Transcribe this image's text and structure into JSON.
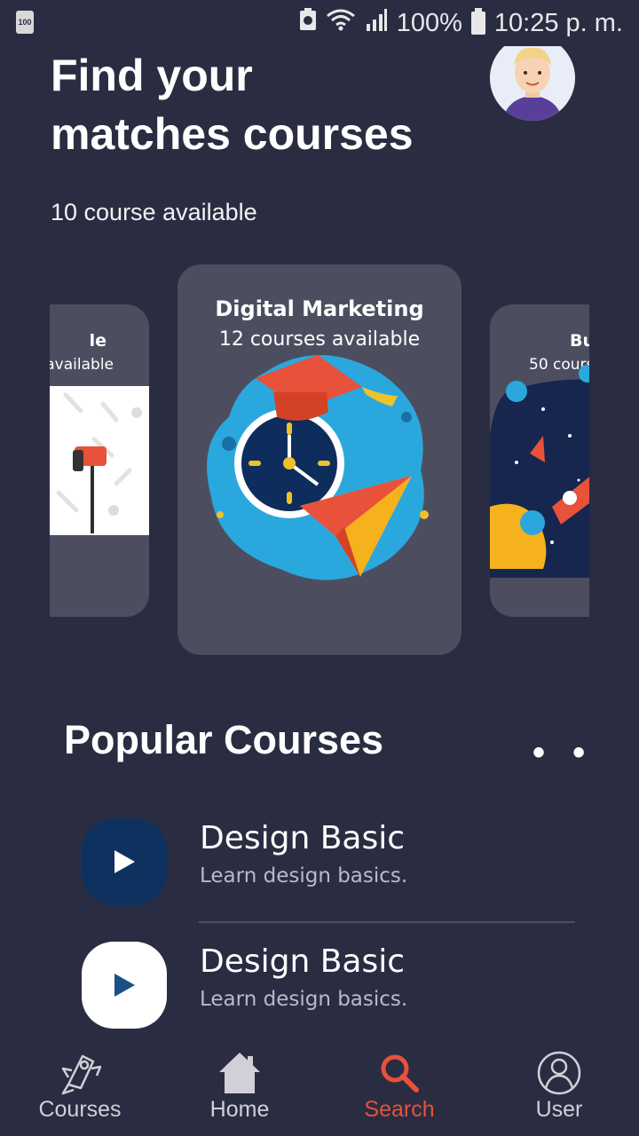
{
  "status_bar": {
    "left_badge": "100",
    "battery": "100%",
    "time": "10:25 p. m."
  },
  "header": {
    "title_line1": "Find your",
    "title_line2": "matches courses",
    "subtitle": "10 course available"
  },
  "carousel": {
    "left": {
      "title_fragment": "le",
      "sub_fragment": "available"
    },
    "center": {
      "title": "Digital Marketing",
      "sub": "12 courses available"
    },
    "right": {
      "title_fragment": "Bu",
      "sub_fragment": "50 cours"
    }
  },
  "popular": {
    "title": "Popular Courses",
    "more": "• •",
    "courses": [
      {
        "title": "Design Basic",
        "desc": "Learn design basics.",
        "button_color": "#0f3160"
      },
      {
        "title": "Design Basic",
        "desc": "Learn design basics.",
        "button_color": "#ffffff"
      }
    ]
  },
  "nav": {
    "items": [
      {
        "label": "Courses",
        "icon": "courses-rocket-icon",
        "active": false
      },
      {
        "label": "Home",
        "icon": "home-icon",
        "active": false
      },
      {
        "label": "Search",
        "icon": "search-icon",
        "active": true
      },
      {
        "label": "User",
        "icon": "user-icon",
        "active": false
      }
    ],
    "active_color": "#e8513a",
    "inactive_color": "#d0d0d6"
  }
}
